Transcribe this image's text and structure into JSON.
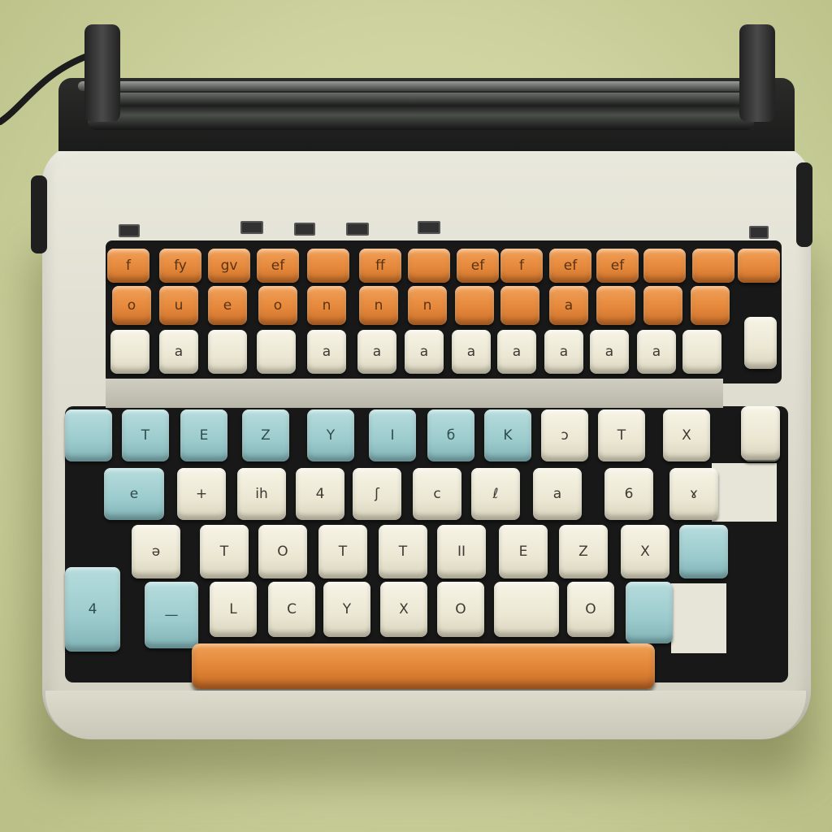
{
  "colors": {
    "background": "#cdd29e",
    "body": "#e1e0d2",
    "key_orange": "#e5883b",
    "key_cream": "#ebe7d3",
    "key_teal": "#9ccbcd"
  },
  "keyboard": {
    "row1": [
      "f",
      "fy",
      "gv",
      "ef",
      "",
      "ff",
      "",
      "ef",
      "f",
      "ef",
      "ef",
      "",
      "",
      ""
    ],
    "row2": [
      "o",
      "u",
      "e",
      "o",
      "n",
      "n",
      "n",
      "",
      "",
      "a",
      "",
      "",
      ""
    ],
    "row3": [
      "",
      "a",
      "",
      "",
      "a",
      "a",
      "a",
      "a",
      "a",
      "a",
      "a",
      "a",
      ""
    ],
    "row4": [
      "",
      "T",
      "E",
      "Z",
      "Y",
      "I",
      "б",
      "K",
      "ɔ",
      "T",
      "X",
      "="
    ],
    "row5": [
      "e",
      "+",
      "ih",
      "4",
      "ʃ",
      "c",
      "ℓ",
      "a",
      "6",
      "ɤ"
    ],
    "row6": [
      "ə",
      "T",
      "O",
      "T",
      "T",
      "II",
      "E",
      "Z",
      "X",
      ""
    ],
    "row7": [
      "4",
      "—",
      "L",
      "C",
      "Y",
      "X",
      "O",
      "",
      "O",
      ""
    ]
  }
}
